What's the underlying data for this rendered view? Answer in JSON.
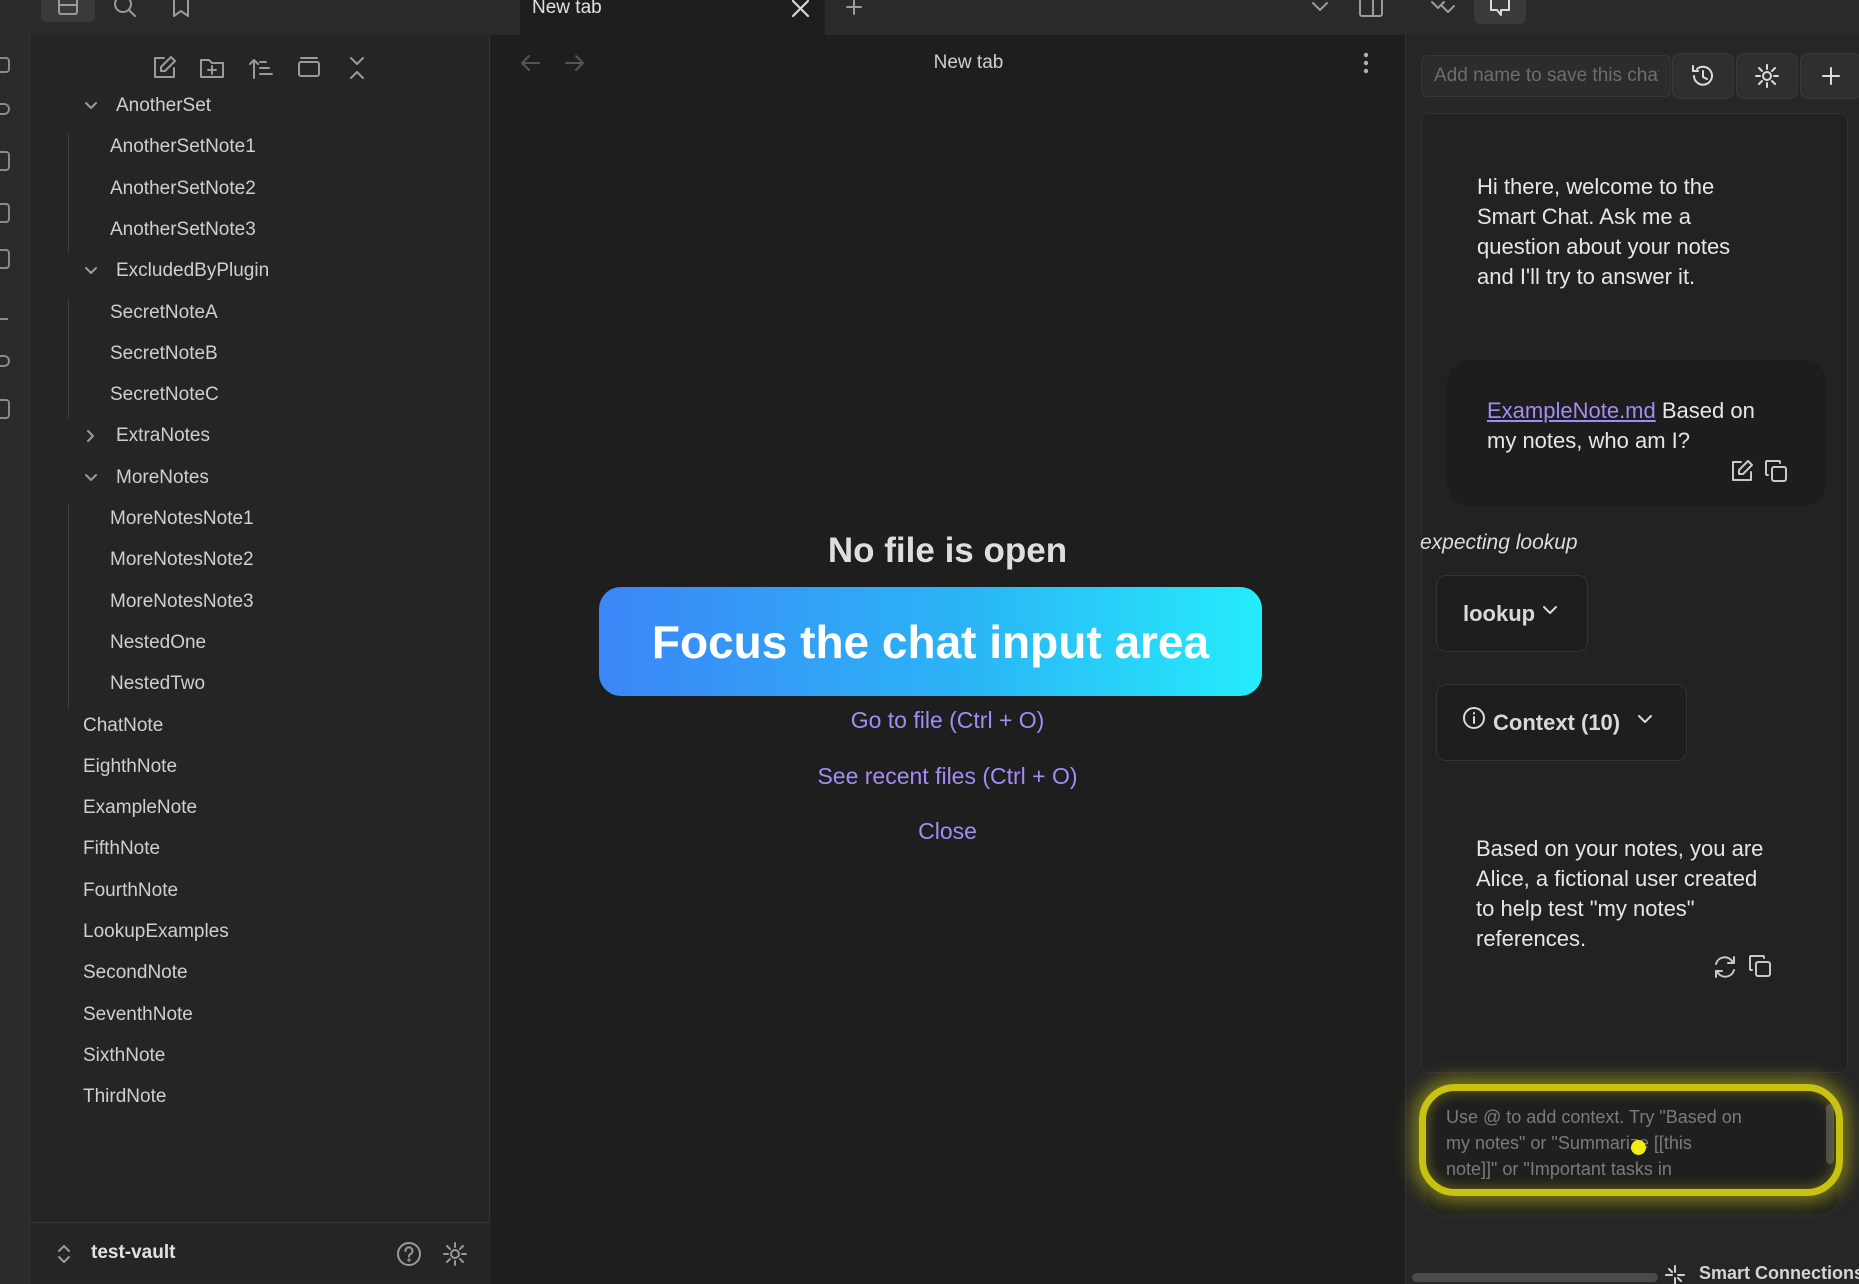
{
  "tabs": {
    "active_tab_label": "New tab"
  },
  "sidebar": {
    "folders": [
      {
        "name": "AnotherSet",
        "expanded": true,
        "children": [
          "AnotherSetNote1",
          "AnotherSetNote2",
          "AnotherSetNote3"
        ]
      },
      {
        "name": "ExcludedByPlugin",
        "expanded": true,
        "children": [
          "SecretNoteA",
          "SecretNoteB",
          "SecretNoteC"
        ]
      },
      {
        "name": "ExtraNotes",
        "expanded": false,
        "children": []
      },
      {
        "name": "MoreNotes",
        "expanded": true,
        "children": [
          "MoreNotesNote1",
          "MoreNotesNote2",
          "MoreNotesNote3",
          "NestedOne",
          "NestedTwo"
        ]
      }
    ],
    "files": [
      "ChatNote",
      "EighthNote",
      "ExampleNote",
      "FifthNote",
      "FourthNote",
      "LookupExamples",
      "SecondNote",
      "SeventhNote",
      "SixthNote",
      "ThirdNote"
    ],
    "vault_name": "test-vault"
  },
  "main": {
    "header_title": "New tab",
    "empty_title": "No file is open",
    "link_go_to_file": "Go to file (Ctrl + O)",
    "link_recent": "See recent files (Ctrl + O)",
    "link_close": "Close"
  },
  "chat": {
    "name_placeholder": "Add name to save this chat",
    "welcome": "Hi there, welcome to the Smart Chat. Ask me a question about your notes and I'll try to answer it.",
    "user_message": {
      "link": "ExampleNote.md",
      "text": " Based on my notes, who am I?"
    },
    "status_text": "expecting lookup",
    "lookup_label": "lookup",
    "context_label": "Context (10)",
    "assistant_reply": "Based on your notes, you are Alice, a fictional user created to help test \"my notes\" references.",
    "input_placeholder": "Use @ to add context. Try \"Based on my notes\" or \"Summarize [[this note]]\" or \"Important tasks in",
    "footer_label": "Smart Connections"
  },
  "overlay": {
    "banner_text": "Focus the chat input area"
  },
  "colors": {
    "accent_link": "#a48bf5",
    "banner_start": "#3c86f7",
    "banner_end": "#25ecfb",
    "highlight": "#c8c312"
  }
}
